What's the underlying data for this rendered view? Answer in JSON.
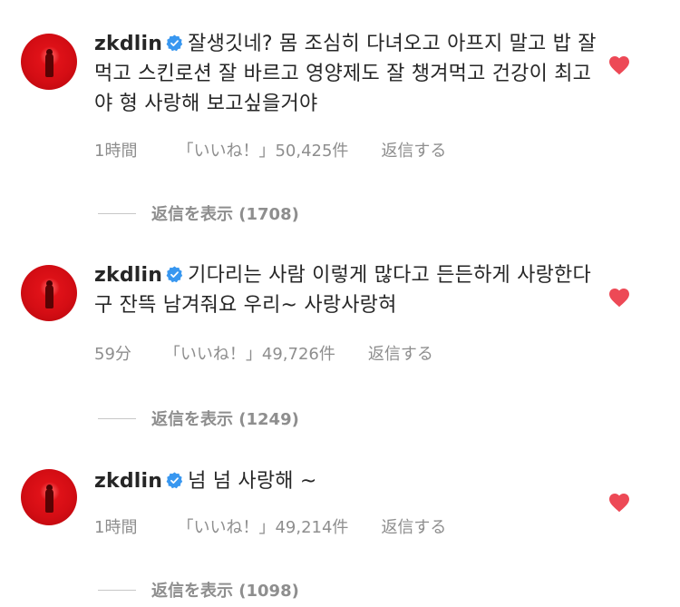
{
  "comments": [
    {
      "username": "zkdlin",
      "text": "잘생깃네? 몸 조심히 다녀오고 아프지 말고 밥 잘먹고 스킨로션 잘 바르고 영양제도 잘 챙겨먹고 건강이 최고야 형  사랑해 보고싶을거야",
      "time": "1時間",
      "likes": "「いいね！」50,425件",
      "reply_label": "返信する",
      "view_replies": "返信を表示 (1708)",
      "liked": true
    },
    {
      "username": "zkdlin",
      "text": "기다리는 사람 이렇게 많다고 든든하게 사랑한다구 잔뜩 남겨줘요 우리~ 사랑사랑혀",
      "time": "59分",
      "likes": "「いいね！」49,726件",
      "reply_label": "返信する",
      "view_replies": "返信を表示 (1249)",
      "liked": true
    },
    {
      "username": "zkdlin",
      "text": "넘 넘 사랑해 ~",
      "time": "1時間",
      "likes": "「いいね！」49,214件",
      "reply_label": "返信する",
      "view_replies": "返信を表示 (1098)",
      "liked": true
    }
  ],
  "colors": {
    "text": "#262626",
    "secondary": "#8e8e8e",
    "verified": "#3897f0",
    "heart": "#ed4956",
    "avatar": "#d40d14"
  },
  "icons": {
    "verified": "verified-badge-icon",
    "heart": "heart-icon"
  }
}
